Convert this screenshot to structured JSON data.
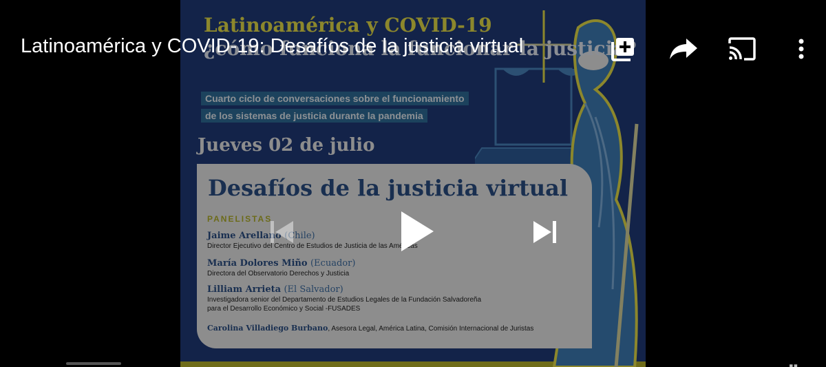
{
  "video": {
    "title": "Latinoamérica y COVID-19: Desafíos de la justicia virtual"
  },
  "poster": {
    "title_line1": "Latinoamérica y COVID-19",
    "title_line2": "¿cómo funciona la funcionar la justicia?",
    "subtitle_line1": "Cuarto ciclo de conversaciones sobre el funcionamiento",
    "subtitle_line2": "de los sistemas de justicia durante la pandemia",
    "date": "Jueves 02 de julio",
    "session_title": "Desafíos de la justicia virtual",
    "panelists_heading": "PANELISTAS",
    "panelists": [
      {
        "name": "Jaime Arellano",
        "country": "(Chile)",
        "role": "Director Ejecutivo del Centro de Estudios de Justicia de las Américas"
      },
      {
        "name": "María Dolores Miño",
        "country": "(Ecuador)",
        "role": "Directora del Observatorio Derechos y Justicia"
      },
      {
        "name": "Lilliam Arrieta",
        "country": "(El Salvador)",
        "role": "Investigadora senior del Departamento de Estudios Legales de la Fundación Salvadoreña",
        "role_line2": "para el Desarrollo Económico y Social -FUSADES"
      }
    ],
    "moderator": {
      "name": "Carolina Villadiego Burbano",
      "role": ", Asesora Legal, América Latina, Comisión Internacional de Juristas"
    }
  },
  "controls": {
    "top_icons": [
      "add-to-queue-icon",
      "share-icon",
      "cast-icon",
      "more-vert-icon"
    ],
    "center_icons": [
      "previous-icon",
      "play-icon",
      "next-icon"
    ]
  },
  "colors": {
    "poster_background": "#213b7b",
    "poster_accent_yellow": "#e9e24a",
    "card_background": "#ececec",
    "card_title_blue": "#2b4f86"
  }
}
